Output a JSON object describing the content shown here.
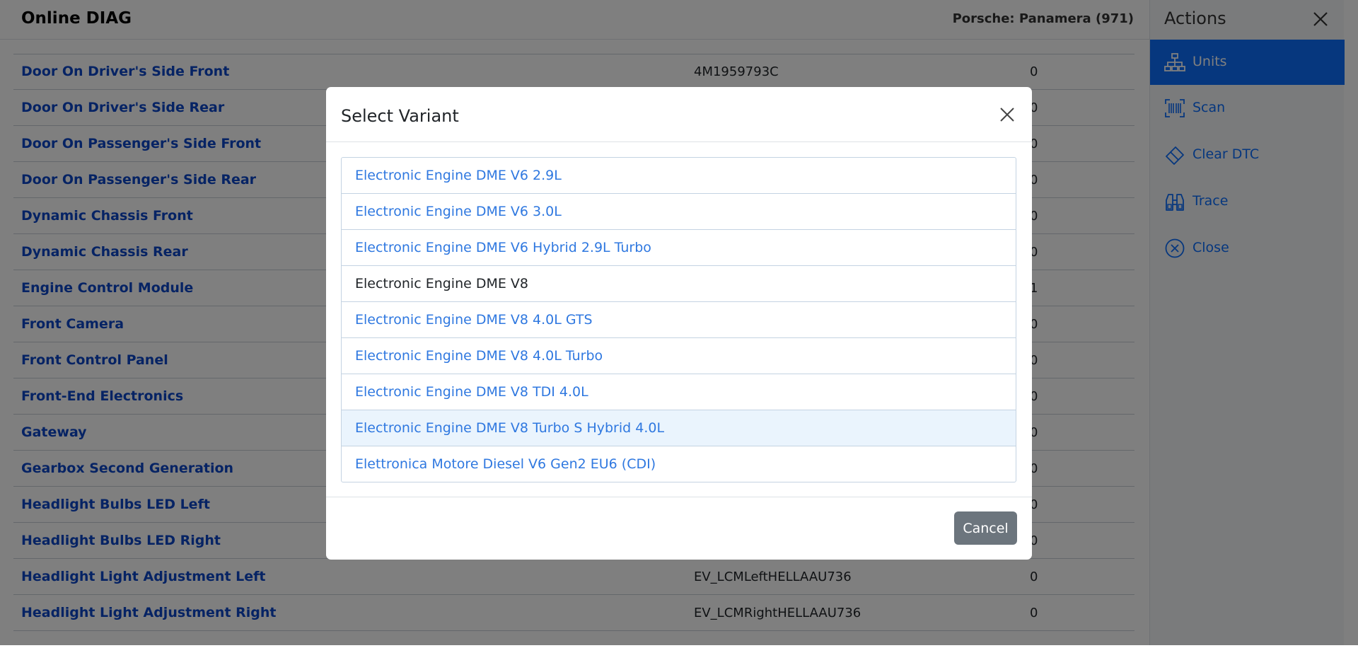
{
  "header": {
    "app_title": "Online DIAG",
    "vehicle": "Porsche:  Panamera (971)"
  },
  "units": [
    {
      "name": "Door On Driver's Side Front",
      "part": "4M1959793C",
      "count": "0"
    },
    {
      "name": "Door On Driver's Side Rear",
      "part": "",
      "count": "0"
    },
    {
      "name": "Door On Passenger's Side Front",
      "part": "",
      "count": "0"
    },
    {
      "name": "Door On Passenger's Side Rear",
      "part": "",
      "count": "0"
    },
    {
      "name": "Dynamic Chassis Front",
      "part": "",
      "count": "0"
    },
    {
      "name": "Dynamic Chassis Rear",
      "part": "",
      "count": "0"
    },
    {
      "name": "Engine Control Module",
      "part": "",
      "count": "1"
    },
    {
      "name": "Front Camera",
      "part": "",
      "count": "0"
    },
    {
      "name": "Front Control Panel",
      "part": "",
      "count": "0"
    },
    {
      "name": "Front-End Electronics",
      "part": "",
      "count": "0"
    },
    {
      "name": "Gateway",
      "part": "",
      "count": "0"
    },
    {
      "name": "Gearbox Second Generation",
      "part": "",
      "count": "0"
    },
    {
      "name": "Headlight Bulbs LED Left",
      "part": "",
      "count": "0"
    },
    {
      "name": "Headlight Bulbs LED Right",
      "part": "",
      "count": "0"
    },
    {
      "name": "Headlight Light Adjustment Left",
      "part": "EV_LCMLeftHELLAAU736",
      "count": "0"
    },
    {
      "name": "Headlight Light Adjustment Right",
      "part": "EV_LCMRightHELLAAU736",
      "count": "0"
    }
  ],
  "sidebar": {
    "title": "Actions",
    "items": [
      {
        "label": "Units",
        "icon": "units-icon"
      },
      {
        "label": "Scan",
        "icon": "barcode-icon"
      },
      {
        "label": "Clear DTC",
        "icon": "eraser-icon"
      },
      {
        "label": "Trace",
        "icon": "binoculars-icon"
      },
      {
        "label": "Close",
        "icon": "close-circle-icon"
      }
    ]
  },
  "modal": {
    "title": "Select Variant",
    "variants": [
      "Electronic Engine DME V6 2.9L",
      "Electronic Engine DME V6 3.0L",
      "Electronic Engine DME V6 Hybrid 2.9L Turbo",
      "Electronic Engine DME V8",
      "Electronic Engine DME V8 4.0L GTS",
      "Electronic Engine DME V8 4.0L Turbo",
      "Electronic Engine DME V8 TDI 4.0L",
      "Electronic Engine DME V8 Turbo S Hybrid 4.0L",
      "Elettronica Motore Diesel V6 Gen2 EU6 (CDI)"
    ],
    "cancel_label": "Cancel"
  },
  "colors": {
    "link": "#0d47c9",
    "accent": "#0d6efd",
    "variant_link": "#2f78e0",
    "cancel_button": "#6c757d"
  }
}
